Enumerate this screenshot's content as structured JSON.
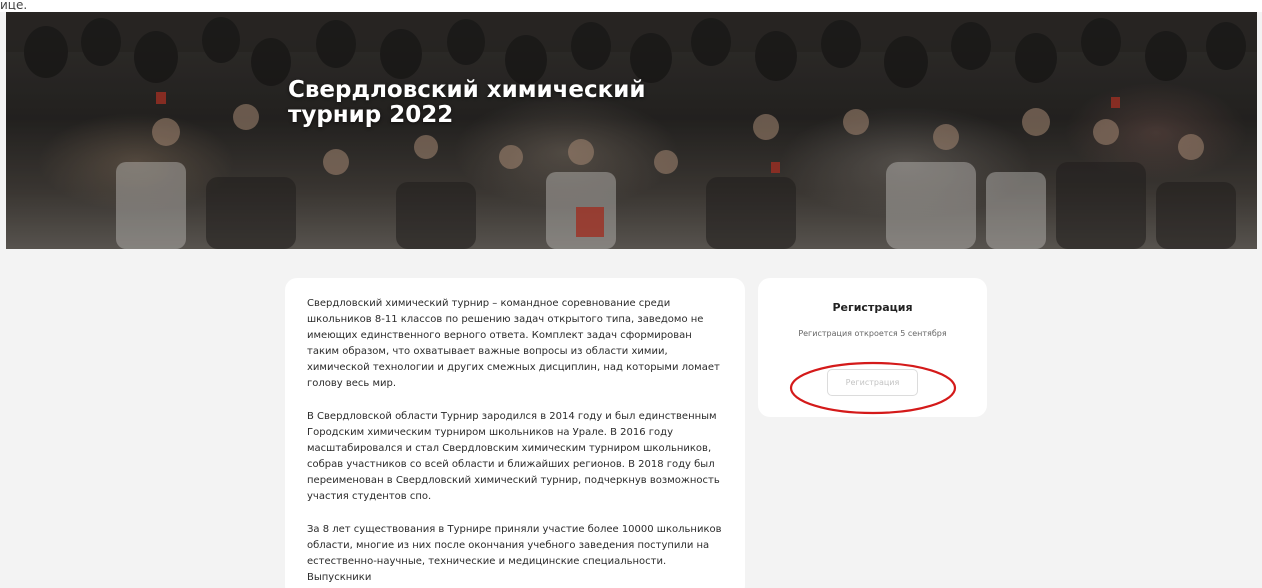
{
  "top_fragment": "ице.",
  "hero": {
    "title": "Свердловский химический турнир 2022"
  },
  "description": {
    "paragraphs": [
      "Свердловский химический турнир – командное соревнование среди школьников 8-11 классов по решению задач открытого типа, заведомо не имеющих единственного верного ответа. Комплект задач сформирован таким образом, что охватывает важные вопросы из области химии, химической технологии и других смежных дисциплин, над которыми ломает голову весь мир.",
      "В Свердловской области Турнир зародился в 2014 году и был единственным Городским химическим турниром школьников на Урале. В 2016 году масштабировался и стал Свердловским химическим турниром школьников, собрав участников со всей области и ближайших регионов. В 2018 году был переименован в Свердловский химический турнир, подчеркнув возможность участия студентов спо.",
      "За 8 лет существования в Турнире приняли участие более 10000 школьников области, многие из них после окончания учебного заведения поступили на естественно-научные, технические и медицинские специальности. Выпускники"
    ]
  },
  "registration": {
    "title": "Регистрация",
    "note": "Регистрация откроется 5 сентября",
    "button_label": "Регистрация"
  },
  "colors": {
    "annotation": "#d41a1a",
    "page_bg": "#f3f3f3",
    "card_bg": "#ffffff"
  }
}
